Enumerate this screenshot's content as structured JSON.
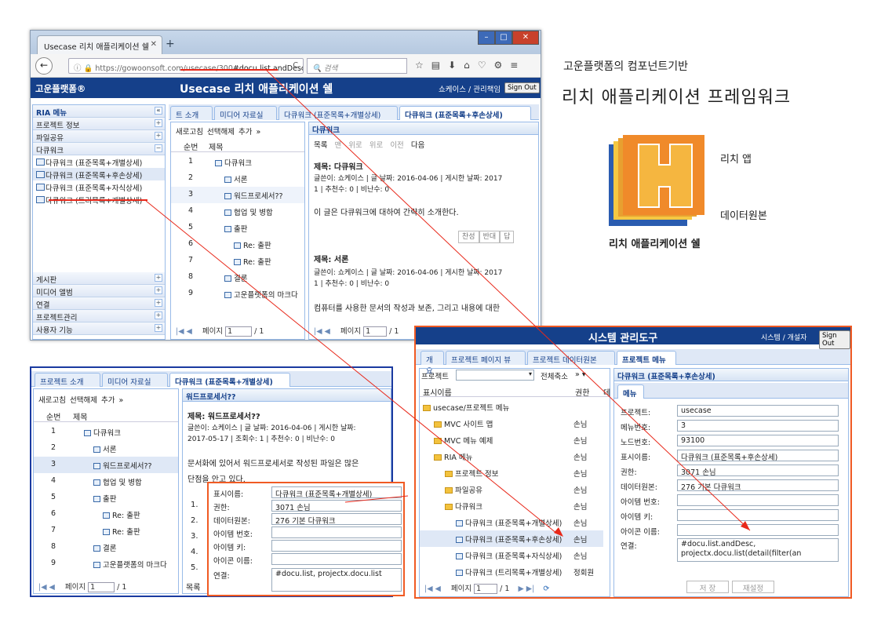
{
  "browser": {
    "tab_title": "Usecase 리치 애플리케이션 쉘",
    "url_prefix": "https://gowoonsoft.com",
    "url_path": "/usecase/300",
    "url_hash": "#docu.list.andDesc",
    "search_placeholder": "검색"
  },
  "app": {
    "logo": "고운플랫폼®",
    "title": "Usecase 리치 애플리케이션 쉘",
    "user": "쇼케이스 / 관리책임",
    "signout": "Sign Out"
  },
  "sidebar": {
    "header": "RIA 메뉴",
    "sections": [
      "프로젝트 정보",
      "파일공유",
      "다큐워크"
    ],
    "items": [
      "다큐워크 (표준목록+개별상세)",
      "다큐워크 (표준목록+후손상세)",
      "다큐워크 (표준목록+자식상세)",
      "다큐워크 (트리목록+개별상세)"
    ],
    "bottom_sections": [
      "게시판",
      "미디어 앨범",
      "연결",
      "프로젝트관리",
      "사용자 기능"
    ]
  },
  "main_tabs": [
    "트 소개",
    "미디어 자료실",
    "다큐워크 (표준목록+개별상세)",
    "다큐워크 (표준목록+후손상세)"
  ],
  "list_toolbar": {
    "refresh": "새로고침",
    "deselect": "선택해제",
    "add": "추가",
    "more": "»"
  },
  "list_columns": {
    "no": "순번",
    "title": "제목"
  },
  "list_rows": [
    {
      "no": "1",
      "title": "다큐워크"
    },
    {
      "no": "2",
      "title": "서론"
    },
    {
      "no": "3",
      "title": "워드프로세서??"
    },
    {
      "no": "4",
      "title": "협업 및 병합"
    },
    {
      "no": "5",
      "title": "출판"
    },
    {
      "no": "6",
      "title": "Re: 출판"
    },
    {
      "no": "7",
      "title": "Re: 출판"
    },
    {
      "no": "8",
      "title": "결론"
    },
    {
      "no": "9",
      "title": "고운플랫폼의 마크다"
    }
  ],
  "pager": {
    "label": "페이지",
    "page": "1",
    "total": "/ 1"
  },
  "detail": {
    "header": "다큐워크",
    "nav": [
      "목록",
      "맨 위로",
      "위로",
      "이전",
      "다음"
    ],
    "post1_title": "제목: 다큐워크",
    "post1_meta": "글쓴이: 쇼케이스 | 글 날짜: 2016-04-06 | 게시한 날짜: 2017",
    "post1_meta2": "1 | 추천수: 0 | 비난수: 0",
    "post1_body": "이 글은 다큐워크에 대하여 간략히 소개한다.",
    "actions": [
      "찬성",
      "반대",
      "답"
    ],
    "post2_title": "제목: 서론",
    "post2_meta": "글쓴이: 쇼케이스 | 글 날짜: 2016-04-06 | 게시한 날짜: 2017",
    "post2_meta2": "1 | 추천수: 0 | 비난수: 0",
    "post2_body": "컴퓨터를 사용한 문서의 작성과 보존, 그리고 내용에 대한"
  },
  "right_text": {
    "line1": "고운플랫폼의 컴포넌트기반",
    "line2": "리치 애플리케이션 프레임워크",
    "rich_app": "리치 앱",
    "data_source": "데이터원본",
    "shell": "리치 애플리케이션 쉘"
  },
  "admin": {
    "title": "시스템 관리도구",
    "user": "시스템 / 개설자",
    "signout": "Sign Out",
    "tabs": [
      "개요",
      "프로젝트 페이지 뷰",
      "프로젝트 데이터원본",
      "프로젝트 메뉴"
    ],
    "project_label": "프로젝트",
    "collapse_all": "전체축소",
    "col_name": "표시이름",
    "col_perm": "권한",
    "col_d": "데",
    "tree": [
      {
        "name": "usecase/프로젝트 메뉴",
        "perm": ""
      },
      {
        "name": "MVC 사이트 맵",
        "perm": "손님"
      },
      {
        "name": "MVC 메뉴 예제",
        "perm": "손님"
      },
      {
        "name": "RIA 메뉴",
        "perm": "손님"
      },
      {
        "name": "프로젝트 정보",
        "perm": "손님"
      },
      {
        "name": "파일공유",
        "perm": "손님"
      },
      {
        "name": "다큐워크",
        "perm": "손님"
      },
      {
        "name": "다큐워크 (표준목록+개별상세)",
        "perm": "손님"
      },
      {
        "name": "다큐워크 (표준목록+후손상세)",
        "perm": "손님"
      },
      {
        "name": "다큐워크 (표준목록+자식상세)",
        "perm": "손님"
      },
      {
        "name": "다큐워크 (트리목록+개별상세)",
        "perm": "정회원"
      }
    ],
    "detail_header": "다큐워크 (표준목록+후손상세)",
    "detail_tab": "메뉴",
    "fields": [
      {
        "label": "프로젝트:",
        "value": "usecase"
      },
      {
        "label": "메뉴번호:",
        "value": "3"
      },
      {
        "label": "노드번호:",
        "value": "93100"
      },
      {
        "label": "표시이름:",
        "value": "다큐워크 (표준목록+후손상세)"
      },
      {
        "label": "권한:",
        "value": "3071 손님"
      },
      {
        "label": "데이터원본:",
        "value": "276 기본 다큐워크"
      },
      {
        "label": "아이템 번호:",
        "value": ""
      },
      {
        "label": "아이템 키:",
        "value": ""
      },
      {
        "label": "아이콘 이름:",
        "value": ""
      }
    ],
    "link_label": "연결:",
    "link_value": "#docu.list.andDesc, projectx.docu.list(detail(filter(an",
    "save": "저 장",
    "rewrite": "재설정",
    "pager": {
      "label": "페이지",
      "page": "1",
      "total": "/ 1"
    }
  },
  "win3": {
    "tabs": [
      "프로젝트 소개",
      "미디어 자료실",
      "다큐워크 (표준목록+개별상세)"
    ],
    "detail_header": "워드프로세서??",
    "post_title": "제목: 워드프로세서??",
    "post_meta": "글쓴이: 쇼케이스 | 글 날짜: 2016-04-06 | 게시한 날짜:",
    "post_meta2": "2017-05-17 | 조회수: 1 | 추천수: 0 | 비난수: 0",
    "post_body1": "문서화에 있어서 워드프로세서로 작성된 파일은 많은",
    "post_body2": "단점을 안고 있다.",
    "list_marks": [
      "1.",
      "2.",
      "3.",
      "4.",
      "5."
    ],
    "nav_short": "목록"
  },
  "popup": {
    "fields": [
      {
        "label": "표시이름:",
        "value": "다큐워크 (표준목록+개별상세)"
      },
      {
        "label": "권한:",
        "value": "3071 손님"
      },
      {
        "label": "데이터원본:",
        "value": "276 기본 다큐워크"
      },
      {
        "label": "아이템 번호:",
        "value": ""
      },
      {
        "label": "아이템 키:",
        "value": ""
      },
      {
        "label": "아이콘 이름:",
        "value": ""
      }
    ],
    "link_label": "연결:",
    "link_value": "#docu.list, projectx.docu.list"
  }
}
